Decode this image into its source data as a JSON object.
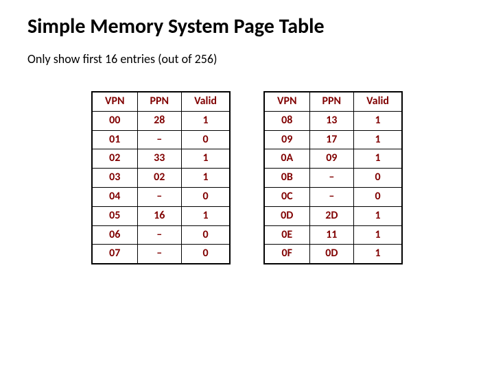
{
  "title": "Simple Memory System Page Table",
  "subtitle": "Only show first 16 entries (out of 256)",
  "headers": {
    "vpn": "VPN",
    "ppn": "PPN",
    "valid": "Valid"
  },
  "left_rows": [
    {
      "vpn": "00",
      "ppn": "28",
      "valid": "1"
    },
    {
      "vpn": "01",
      "ppn": "–",
      "valid": "0"
    },
    {
      "vpn": "02",
      "ppn": "33",
      "valid": "1"
    },
    {
      "vpn": "03",
      "ppn": "02",
      "valid": "1"
    },
    {
      "vpn": "04",
      "ppn": "–",
      "valid": "0"
    },
    {
      "vpn": "05",
      "ppn": "16",
      "valid": "1"
    },
    {
      "vpn": "06",
      "ppn": "–",
      "valid": "0"
    },
    {
      "vpn": "07",
      "ppn": "–",
      "valid": "0"
    }
  ],
  "right_rows": [
    {
      "vpn": "08",
      "ppn": "13",
      "valid": "1"
    },
    {
      "vpn": "09",
      "ppn": "17",
      "valid": "1"
    },
    {
      "vpn": "0A",
      "ppn": "09",
      "valid": "1"
    },
    {
      "vpn": "0B",
      "ppn": "–",
      "valid": "0"
    },
    {
      "vpn": "0C",
      "ppn": "–",
      "valid": "0"
    },
    {
      "vpn": "0D",
      "ppn": "2D",
      "valid": "1"
    },
    {
      "vpn": "0E",
      "ppn": "11",
      "valid": "1"
    },
    {
      "vpn": "0F",
      "ppn": "0D",
      "valid": "1"
    }
  ]
}
